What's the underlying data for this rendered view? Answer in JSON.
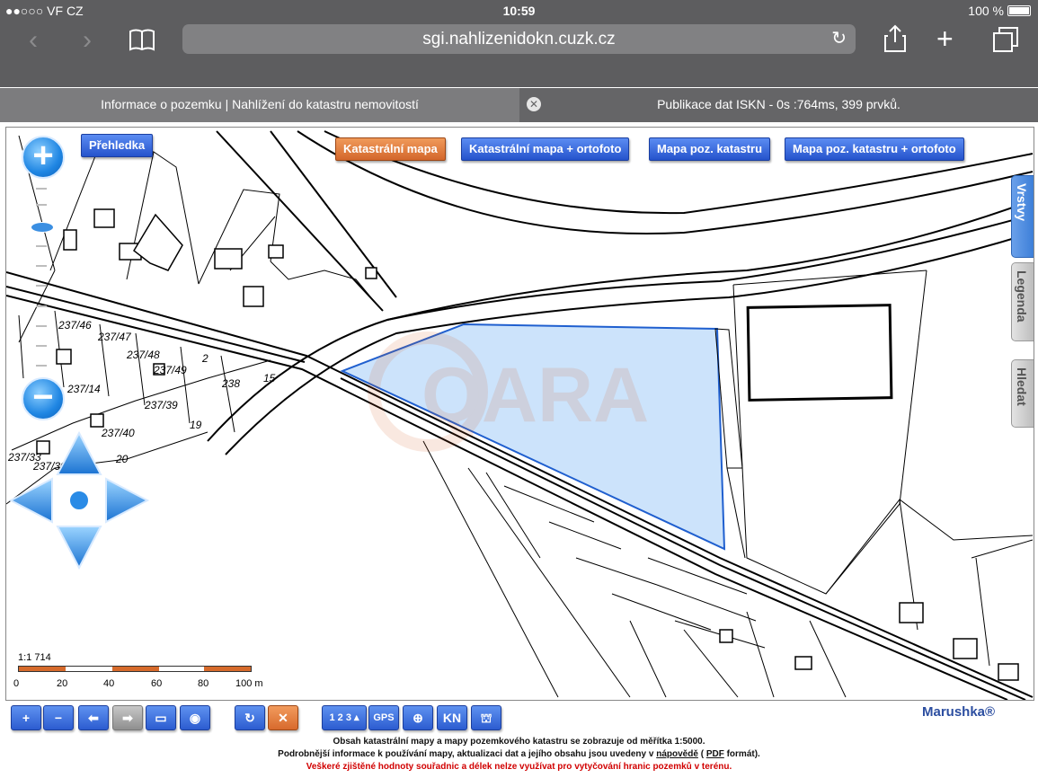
{
  "status": {
    "carrier": "●●○○○ VF CZ",
    "time": "10:59",
    "battery": "100 %"
  },
  "browser": {
    "url": "sgi.nahlizenidokn.cuzk.cz"
  },
  "tabs": [
    {
      "title": "Informace o pozemku | Nahlížení do katastru nemovitostí"
    },
    {
      "title": "Publikace dat ISKN - 0s :764ms, 399 prvků."
    }
  ],
  "map": {
    "overview_button": "Přehledka",
    "layer_buttons": [
      "Katastrální mapa",
      "Katastrální mapa + ortofoto",
      "Mapa poz. katastru",
      "Mapa poz. katastru + ortofoto"
    ],
    "side_tabs": [
      "Vrstvy",
      "Legenda",
      "Hledat"
    ],
    "scale": {
      "ratio": "1:1 714",
      "labels": [
        "0",
        "20",
        "40",
        "60",
        "80",
        "100 m"
      ]
    },
    "watermark": "QARA",
    "parcel_labels": [
      "237/46",
      "237/47",
      "237/48",
      "237/49",
      "237/14",
      "237/39",
      "237/40",
      "237/30",
      "237/33",
      "238",
      "19",
      "20",
      "2",
      "15"
    ],
    "selection_color": "#cce3fb"
  },
  "toolbar": {
    "brand": "Marushka®",
    "gps": "GPS",
    "kn": "KN",
    "counter": "1 2 3"
  },
  "footer": {
    "line1": "Obsah katastrální mapy a mapy pozemkového katastru se zobrazuje od měřítka 1:5000.",
    "line2_pre": "Podrobnější informace k používání mapy, aktualizaci dat a jejího obsahu jsou uvedeny v",
    "help_link": "nápovědě",
    "paren_open": "(",
    "pdf_link": "PDF",
    "line2_post": "formát).",
    "line3": "Veškeré zjištěné hodnoty souřadnic a délek nelze využívat pro vytyčování hranic pozemků v terénu."
  }
}
